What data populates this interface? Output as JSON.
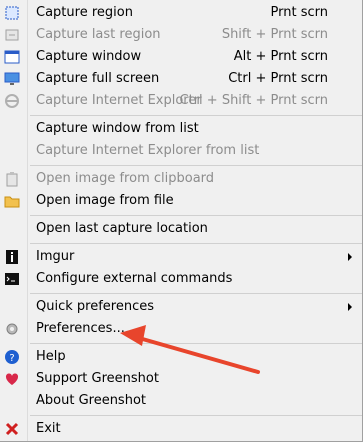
{
  "menu": {
    "items": [
      {
        "label": "Capture region",
        "shortcut": "Prnt scrn",
        "icon": "region-icon",
        "disabled": false
      },
      {
        "label": "Capture last region",
        "shortcut": "Shift + Prnt scrn",
        "icon": "last-region-icon",
        "disabled": true
      },
      {
        "label": "Capture window",
        "shortcut": "Alt + Prnt scrn",
        "icon": "window-icon",
        "disabled": false
      },
      {
        "label": "Capture full screen",
        "shortcut": "Ctrl + Prnt scrn",
        "icon": "monitor-icon",
        "disabled": false
      },
      {
        "label": "Capture Internet Explorer",
        "shortcut": "Ctrl + Shift + Prnt scrn",
        "icon": "ie-icon",
        "disabled": true
      },
      {
        "label": "Capture window from list",
        "disabled": false
      },
      {
        "label": "Capture Internet Explorer from list",
        "disabled": true
      },
      {
        "label": "Open image from clipboard",
        "icon": "clipboard-icon",
        "disabled": true
      },
      {
        "label": "Open image from file",
        "icon": "folder-icon",
        "disabled": false
      },
      {
        "label": "Open last capture location",
        "disabled": false
      },
      {
        "label": "Imgur",
        "icon": "imgur-icon",
        "submenu": true,
        "disabled": false
      },
      {
        "label": "Configure external commands",
        "icon": "terminal-icon",
        "disabled": false
      },
      {
        "label": "Quick preferences",
        "submenu": true,
        "disabled": false
      },
      {
        "label": "Preferences...",
        "icon": "gear-icon",
        "disabled": false
      },
      {
        "label": "Help",
        "icon": "help-icon",
        "disabled": false
      },
      {
        "label": "Support Greenshot",
        "icon": "heart-icon",
        "disabled": false
      },
      {
        "label": "About Greenshot",
        "disabled": false
      },
      {
        "label": "Exit",
        "icon": "close-icon",
        "disabled": false
      }
    ]
  },
  "colors": {
    "annotation_arrow": "#e8452c",
    "help": "#1e5fd0",
    "heart": "#d8284a",
    "exit": "#d02020"
  }
}
